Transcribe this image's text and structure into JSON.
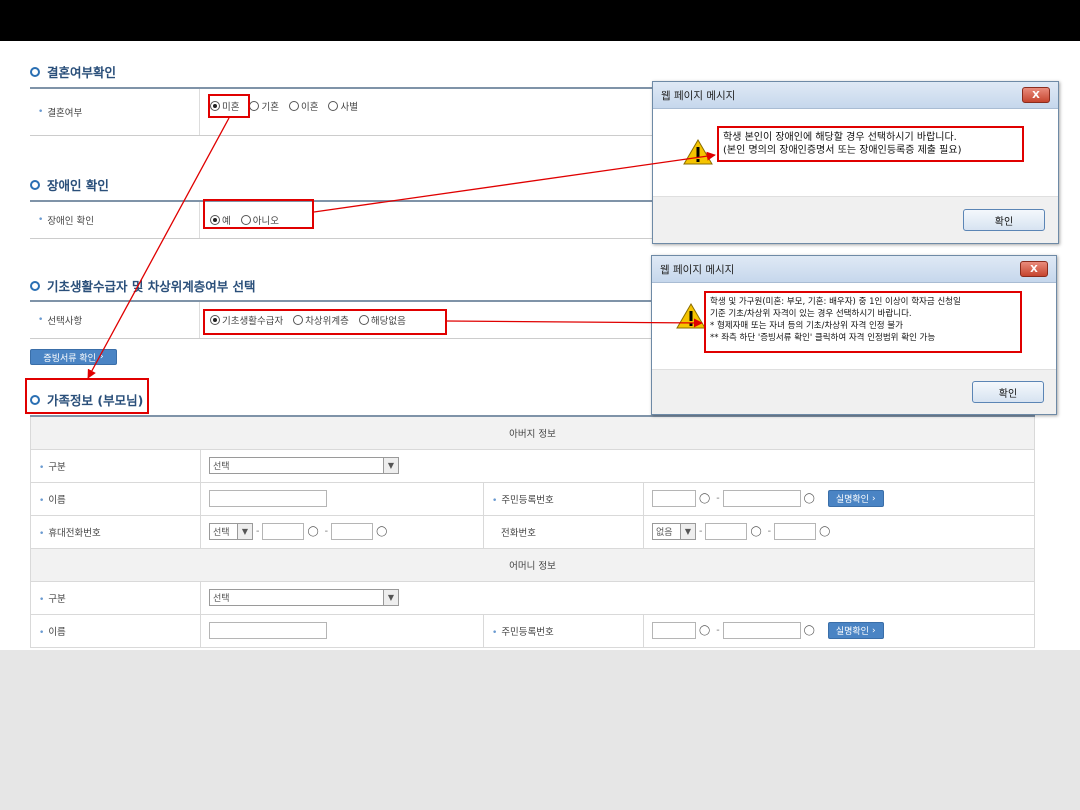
{
  "marriage_section": {
    "title": "결혼여부확인",
    "label": "결혼여부",
    "options": [
      "미혼",
      "기혼",
      "이혼",
      "사별"
    ],
    "selected": "미혼"
  },
  "disability_section": {
    "title": "장애인 확인",
    "label": "장애인 확인",
    "options": [
      "예",
      "아니오"
    ],
    "selected": "예"
  },
  "welfare_section": {
    "title": "기초생활수급자 및 차상위계층여부 선택",
    "label": "선택사항",
    "options": [
      "기초생활수급자",
      "차상위계층",
      "해당없음"
    ],
    "selected": "기초생활수급자",
    "proof_button": "증빙서류 확인"
  },
  "family_section": {
    "title": "가족정보 (부모님)",
    "father_header": "아버지 정보",
    "mother_header": "어머니 정보",
    "category_label": "구분",
    "category_value": "선택",
    "name_label": "이름",
    "rrn_label": "주민등록번호",
    "verify_button": "실명확인",
    "mobile_label": "휴대전화번호",
    "mobile_select": "선택",
    "phone_label": "전화번호",
    "phone_select": "없음"
  },
  "dialog1": {
    "title": "웹 페이지 메시지",
    "close": "X",
    "line1": "학생 본인이 장애인에 해당할 경우 선택하시기 바랍니다.",
    "line2": "(본인 명의의 장애인증명서 또는 장애인등록증 제출 필요)",
    "ok": "확인"
  },
  "dialog2": {
    "title": "웹 페이지 메시지",
    "close": "X",
    "line1": "학생 및 가구원(미혼: 부모, 기혼: 배우자) 중 1인 이상이 학자금 신청일",
    "line2": "기준 기초/차상위 자격이 있는 경우 선택하시기 바랍니다.",
    "line3": "* 형제자매 또는 자녀 등의 기초/차상위 자격 인정 불가",
    "line4": "** 좌측 하단 '증빙서류 확인' 클릭하여 자격 인정범위 확인 가능",
    "ok": "확인"
  },
  "colors": {
    "accent_red": "#e00000",
    "section_blue": "#2a4f7a",
    "button_blue": "#4a84c4"
  },
  "icons": [
    "warning-icon",
    "mouse-icon",
    "chevron-right-icon",
    "close-icon"
  ]
}
